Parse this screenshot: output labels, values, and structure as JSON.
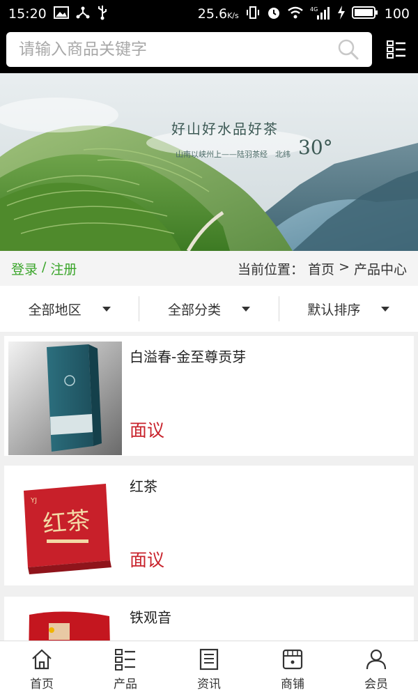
{
  "status_bar": {
    "time": "15:20",
    "speed": "25.6",
    "speed_unit": "K/s",
    "battery": "100",
    "network": "4G"
  },
  "search": {
    "placeholder": "请输入商品关键字"
  },
  "banner": {
    "title": "好山好水品好茶",
    "subtitle": "山南以峡州上——陆羽茶经　北纬",
    "degree": "30°"
  },
  "account": {
    "login": "登录",
    "separator": "/",
    "register": "注册"
  },
  "breadcrumb": {
    "prefix": "当前位置：",
    "home": "首页",
    "separator": ">",
    "current": "产品中心"
  },
  "filters": [
    {
      "label": "全部地区"
    },
    {
      "label": "全部分类"
    },
    {
      "label": "默认排序"
    }
  ],
  "products": [
    {
      "name": "白溢春-金至尊贡芽",
      "price": "面议"
    },
    {
      "name": "红茶",
      "price": "面议"
    },
    {
      "name": "铁观音",
      "price": ""
    }
  ],
  "bottom_nav": [
    {
      "label": "首页",
      "icon": "home-icon"
    },
    {
      "label": "产品",
      "icon": "product-list-icon"
    },
    {
      "label": "资讯",
      "icon": "news-icon"
    },
    {
      "label": "商铺",
      "icon": "shop-icon"
    },
    {
      "label": "会员",
      "icon": "member-icon"
    }
  ],
  "colors": {
    "accent_green": "#3aa52a",
    "price_red": "#c8232c",
    "header_bg": "#000000"
  }
}
